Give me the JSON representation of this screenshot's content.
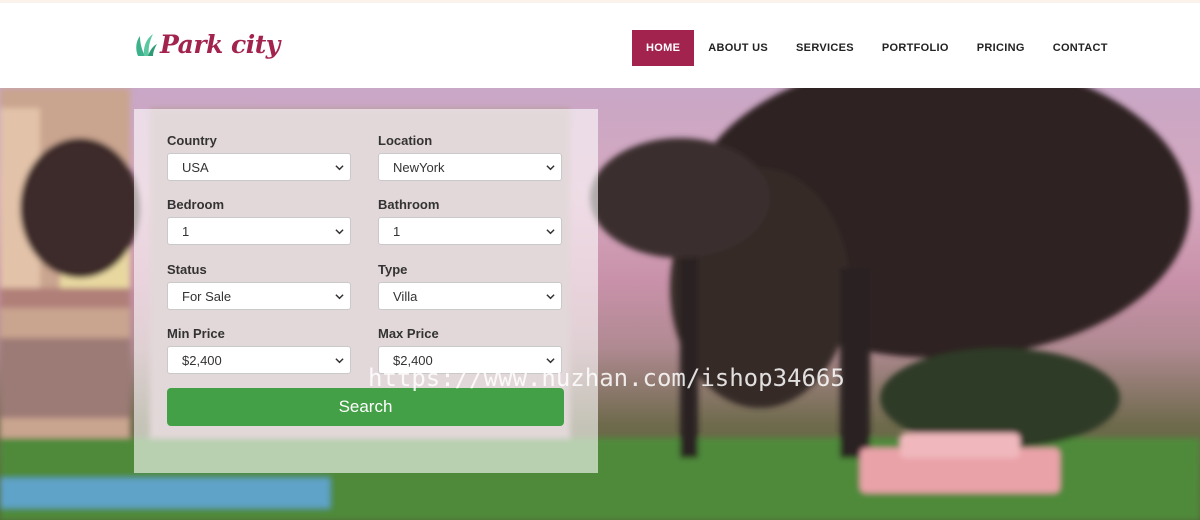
{
  "header": {
    "logo_text": "Park city",
    "nav": [
      {
        "label": "HOME",
        "active": true
      },
      {
        "label": "ABOUT US",
        "active": false
      },
      {
        "label": "SERVICES",
        "active": false
      },
      {
        "label": "PORTFOLIO",
        "active": false
      },
      {
        "label": "PRICING",
        "active": false
      },
      {
        "label": "CONTACT",
        "active": false
      }
    ]
  },
  "search": {
    "country": {
      "label": "Country",
      "value": "USA"
    },
    "location": {
      "label": "Location",
      "value": "NewYork"
    },
    "bedroom": {
      "label": "Bedroom",
      "value": "1"
    },
    "bathroom": {
      "label": "Bathroom",
      "value": "1"
    },
    "status": {
      "label": "Status",
      "value": "For Sale"
    },
    "type": {
      "label": "Type",
      "value": "Villa"
    },
    "min_price": {
      "label": "Min Price",
      "value": "$2,400"
    },
    "max_price": {
      "label": "Max Price",
      "value": "$2,400"
    },
    "button_label": "Search"
  },
  "watermark": "https://www.huzhan.com/ishop34665",
  "colors": {
    "brand": "#a3234f",
    "button": "#43a047",
    "logo_leaf": "#3bb18c"
  },
  "icons": {
    "logo": "leaf-icon",
    "select": "chevron-down-icon"
  }
}
